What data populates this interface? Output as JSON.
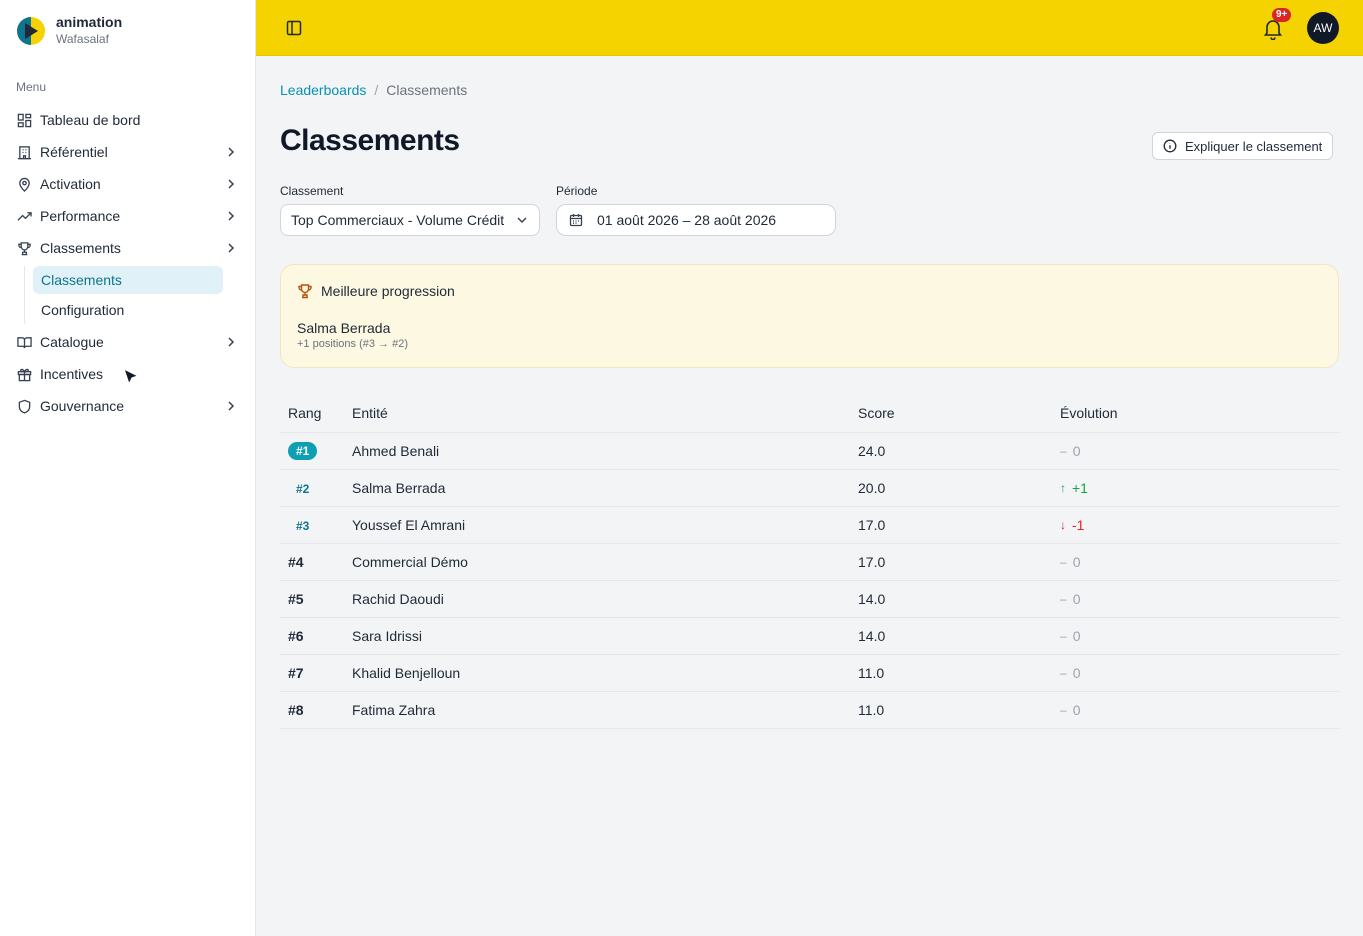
{
  "brand": {
    "title": "animation",
    "subtitle": "Wafasalaf"
  },
  "sidebar": {
    "menu_label": "Menu",
    "items": [
      {
        "label": "Tableau de bord",
        "icon": "dashboard-icon",
        "chevron": false
      },
      {
        "label": "Référentiel",
        "icon": "building-icon",
        "chevron": true
      },
      {
        "label": "Activation",
        "icon": "map-pin-icon",
        "chevron": true
      },
      {
        "label": "Performance",
        "icon": "trending-up-icon",
        "chevron": true
      },
      {
        "label": "Classements",
        "icon": "trophy-icon",
        "chevron": true
      }
    ],
    "sub_items": [
      {
        "label": "Classements",
        "active": true
      },
      {
        "label": "Configuration",
        "active": false
      }
    ],
    "items_after": [
      {
        "label": "Catalogue",
        "icon": "book-icon",
        "chevron": true
      },
      {
        "label": "Incentives",
        "icon": "gift-icon",
        "chevron": false
      },
      {
        "label": "Gouvernance",
        "icon": "shield-icon",
        "chevron": true
      }
    ]
  },
  "topbar": {
    "notification_count": "9+",
    "avatar_initials": "AW"
  },
  "breadcrumb": {
    "link": "Leaderboards",
    "separator": "/",
    "current": "Classements"
  },
  "page": {
    "title": "Classements",
    "explain_button": "Expliquer le classement"
  },
  "filters": {
    "classement_label": "Classement",
    "classement_value": "Top Commerciaux - Volume Crédit",
    "periode_label": "Période",
    "periode_value": "01 août 2026 – 28 août 2026"
  },
  "highlight": {
    "title": "Meilleure progression",
    "name": "Salma Berrada",
    "detail": "+1 positions (#3 → #2)"
  },
  "table": {
    "headers": {
      "rank": "Rang",
      "entity": "Entité",
      "score": "Score",
      "evolution": "Évolution"
    },
    "rows": [
      {
        "rank": "#1",
        "entity": "Ahmed Benali",
        "score": "24.0",
        "evolution": "0",
        "trend": "neutral"
      },
      {
        "rank": "#2",
        "entity": "Salma Berrada",
        "score": "20.0",
        "evolution": "+1",
        "trend": "up"
      },
      {
        "rank": "#3",
        "entity": "Youssef El Amrani",
        "score": "17.0",
        "evolution": "-1",
        "trend": "down"
      },
      {
        "rank": "#4",
        "entity": "Commercial Démo",
        "score": "17.0",
        "evolution": "0",
        "trend": "neutral"
      },
      {
        "rank": "#5",
        "entity": "Rachid Daoudi",
        "score": "14.0",
        "evolution": "0",
        "trend": "neutral"
      },
      {
        "rank": "#6",
        "entity": "Sara Idrissi",
        "score": "14.0",
        "evolution": "0",
        "trend": "neutral"
      },
      {
        "rank": "#7",
        "entity": "Khalid Benjelloun",
        "score": "11.0",
        "evolution": "0",
        "trend": "neutral"
      },
      {
        "rank": "#8",
        "entity": "Fatima Zahra",
        "score": "11.0",
        "evolution": "0",
        "trend": "neutral"
      }
    ]
  },
  "colors": {
    "topbar": "#f5d300",
    "accent": "#0e9fb3",
    "up": "#16a34a",
    "down": "#dc2626"
  }
}
